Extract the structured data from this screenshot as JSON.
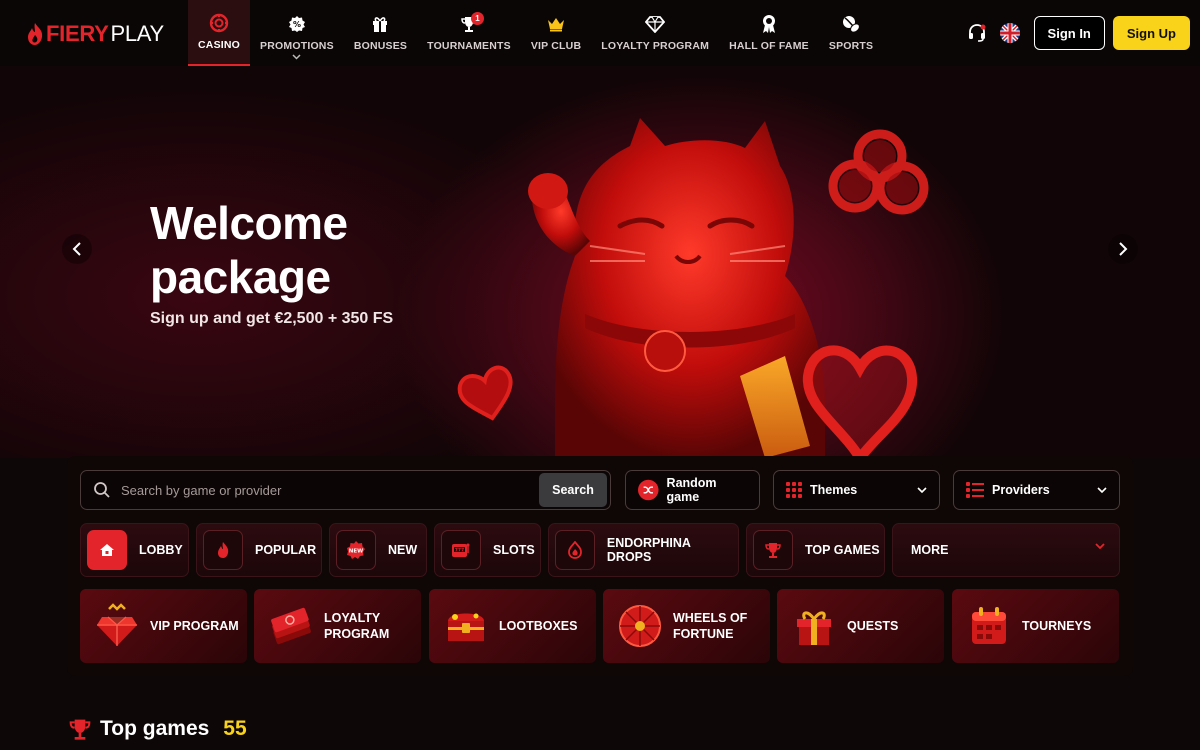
{
  "brand": {
    "part1": "FIERY",
    "part2": "PLAY"
  },
  "nav": [
    {
      "label": "CASINO",
      "icon": "chip-icon",
      "active": true
    },
    {
      "label": "PROMOTIONS",
      "icon": "gear-badge-icon",
      "has_dropdown": true
    },
    {
      "label": "BONUSES",
      "icon": "gift-icon"
    },
    {
      "label": "TOURNAMENTS",
      "icon": "trophy-icon",
      "badge": "1"
    },
    {
      "label": "VIP CLUB",
      "icon": "crown-icon"
    },
    {
      "label": "LOYALTY PROGRAM",
      "icon": "diamond-icon"
    },
    {
      "label": "HALL OF FAME",
      "icon": "medal-icon"
    },
    {
      "label": "SPORTS",
      "icon": "ball-icon"
    }
  ],
  "header": {
    "sign_in": "Sign In",
    "sign_up": "Sign Up"
  },
  "hero": {
    "title": "Welcome package",
    "subtitle": "Sign up and get €2,500 + 350 FS"
  },
  "search": {
    "placeholder": "Search by game or provider",
    "button": "Search"
  },
  "controls": {
    "random": "Random game",
    "themes": "Themes",
    "providers": "Providers"
  },
  "categories": [
    {
      "label": "LOBBY",
      "icon": "home-icon",
      "active": true
    },
    {
      "label": "POPULAR",
      "icon": "flame-icon"
    },
    {
      "label": "NEW",
      "icon": "new-badge-icon"
    },
    {
      "label": "SLOTS",
      "icon": "slot-machine-icon"
    },
    {
      "label": "ENDORPHINA DROPS",
      "icon": "drop-flame-icon"
    },
    {
      "label": "TOP GAMES",
      "icon": "trophy-icon"
    },
    {
      "label": "MORE",
      "icon": "chevron-down-icon"
    }
  ],
  "promos": [
    {
      "label": "VIP PROGRAM",
      "icon": "vip-diamond-icon"
    },
    {
      "label": "LOYALTY PROGRAM",
      "icon": "cash-stack-icon"
    },
    {
      "label": "LOOTBOXES",
      "icon": "treasure-chest-icon"
    },
    {
      "label": "WHEELS OF FORTUNE",
      "icon": "fortune-wheel-icon"
    },
    {
      "label": "QUESTS",
      "icon": "gift-box-icon"
    },
    {
      "label": "TOURNEYS",
      "icon": "calendar-icon"
    }
  ],
  "section": {
    "title": "Top games",
    "count": "55"
  },
  "colors": {
    "accent": "#e3242b",
    "cta": "#f9d21a",
    "background": "#0d0707"
  }
}
